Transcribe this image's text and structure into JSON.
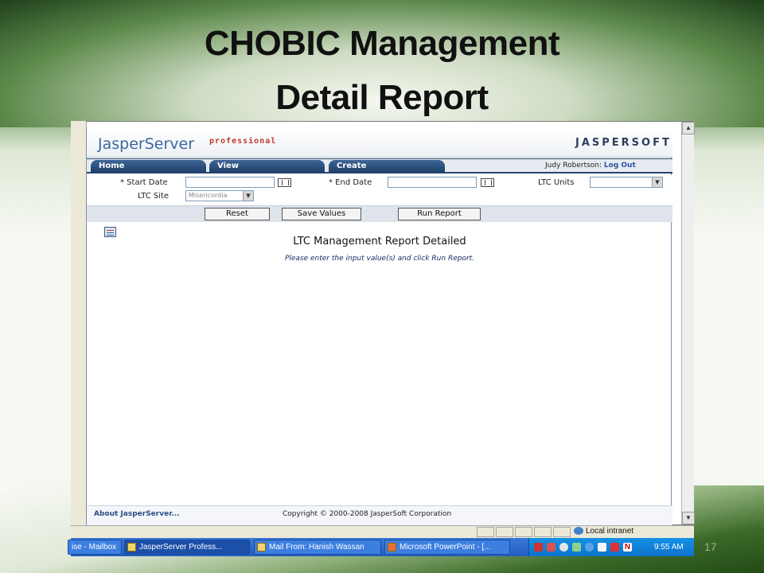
{
  "slide": {
    "title_line1": "CHOBIC Management",
    "title_line2": "Detail Report",
    "slide_number": "17"
  },
  "app": {
    "logo_left": "JasperServer",
    "logo_tagline": "professional",
    "logo_right": "JASPERSOFT",
    "nav_tabs": [
      {
        "label": "Home",
        "icon": ""
      },
      {
        "label": "View"
      },
      {
        "label": "Create"
      }
    ],
    "user_name": "Judy Robertson:",
    "logout_label": "Log Out"
  },
  "filters": {
    "start_date_label": "* Start Date",
    "start_date_value": "",
    "end_date_label": "* End Date",
    "end_date_value": "",
    "ltc_units_label": "LTC Units",
    "ltc_units_value": "",
    "ltc_site_label": "LTC Site",
    "ltc_site_value": "Misericordia"
  },
  "buttons": {
    "reset": "Reset",
    "save_values": "Save Values",
    "run_report": "Run Report"
  },
  "report": {
    "title": "LTC Management Report Detailed",
    "message": "Please enter the input value(s) and click Run Report."
  },
  "footer": {
    "about": "About JasperServer...",
    "copyright": "Copyright © 2000-2008 JasperSoft Corporation"
  },
  "statusbar": {
    "zone": "Local intranet"
  },
  "taskbar": {
    "tasks": [
      {
        "label": "ise - Mailbox"
      },
      {
        "label": "JasperServer Profess..."
      },
      {
        "label": "Mail From: Hanish Wassan"
      },
      {
        "label": "Microsoft PowerPoint - [..."
      }
    ],
    "clock": "9:55 AM"
  },
  "colors": {
    "brand_blue": "#3b67a1",
    "nav_dark": "#1e3f69",
    "taskbar_blue": "#245ec0"
  }
}
